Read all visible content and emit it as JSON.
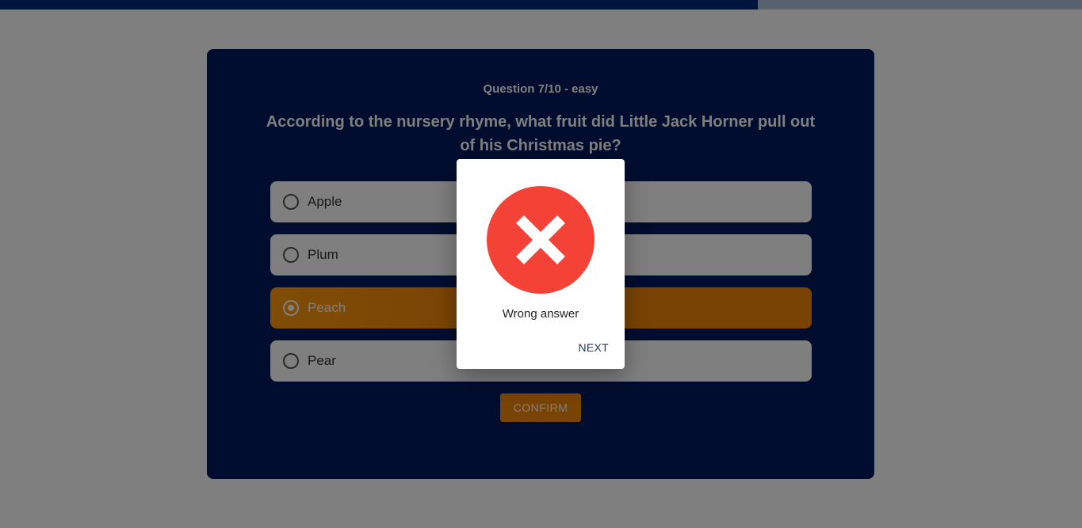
{
  "progress": {
    "fraction": 0.7
  },
  "quiz": {
    "meta": "Question 7/10 - easy",
    "question": "According to the nursery rhyme, what fruit did Little Jack Horner pull out of his Christmas pie?",
    "answers": [
      {
        "label": "Apple",
        "selected": false
      },
      {
        "label": "Plum",
        "selected": false
      },
      {
        "label": "Peach",
        "selected": true
      },
      {
        "label": "Pear",
        "selected": false
      }
    ],
    "confirm_label": "CONFIRM"
  },
  "dialog": {
    "icon": "error-x-icon",
    "message": "Wrong answer",
    "next_label": "NEXT"
  },
  "colors": {
    "card_bg": "#001b5c",
    "accent": "#f28708",
    "error_red": "#f44336"
  }
}
